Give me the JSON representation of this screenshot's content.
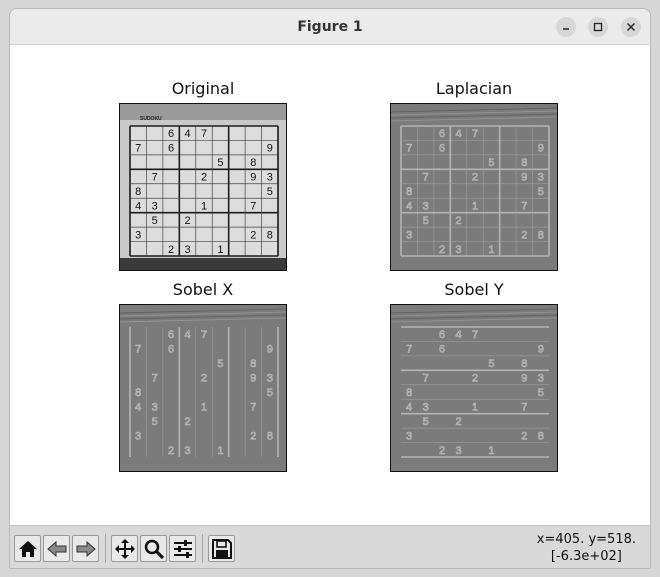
{
  "window": {
    "title": "Figure 1"
  },
  "panels": [
    {
      "title": "Original"
    },
    {
      "title": "Laplacian"
    },
    {
      "title": "Sobel X"
    },
    {
      "title": "Sobel Y"
    }
  ],
  "puzzle": {
    "header_text": "SUDOKU",
    "rows": [
      [
        "",
        "",
        "6",
        "4",
        "7",
        "",
        "",
        "",
        ""
      ],
      [
        "7",
        "",
        "6",
        "",
        "",
        "",
        "",
        "",
        "9"
      ],
      [
        "",
        "",
        "",
        "",
        "",
        "5",
        "",
        "8",
        ""
      ],
      [
        "",
        "7",
        "",
        "",
        "2",
        "",
        "",
        "9",
        "3"
      ],
      [
        "8",
        "",
        "",
        "",
        "",
        "",
        "",
        "",
        "5"
      ],
      [
        "4",
        "3",
        "",
        "",
        "1",
        "",
        "",
        "7",
        ""
      ],
      [
        "",
        "5",
        "",
        "2",
        "",
        "",
        "",
        "",
        ""
      ],
      [
        "3",
        "",
        "",
        "",
        "",
        "",
        "",
        "2",
        "8"
      ],
      [
        "",
        "",
        "2",
        "3",
        "",
        "1",
        "",
        "",
        ""
      ]
    ]
  },
  "toolbar": {
    "buttons": [
      {
        "name": "home-button",
        "icon": "home-icon"
      },
      {
        "name": "back-button",
        "icon": "arrow-left-icon"
      },
      {
        "name": "forward-button",
        "icon": "arrow-right-icon"
      },
      {
        "name": "pan-button",
        "icon": "move-icon"
      },
      {
        "name": "zoom-button",
        "icon": "magnifier-icon"
      },
      {
        "name": "configure-subplots-button",
        "icon": "sliders-icon"
      },
      {
        "name": "save-button",
        "icon": "floppy-disk-icon"
      }
    ],
    "coords_line1": "x=405. y=518.",
    "coords_line2": "[-6.3e+02]"
  },
  "colors": {
    "titlebar": "#ebebeb",
    "toolbar": "#d9d9d9",
    "original_bg": "#c9c9c9",
    "filtered_bg": "#7b7b7b"
  }
}
